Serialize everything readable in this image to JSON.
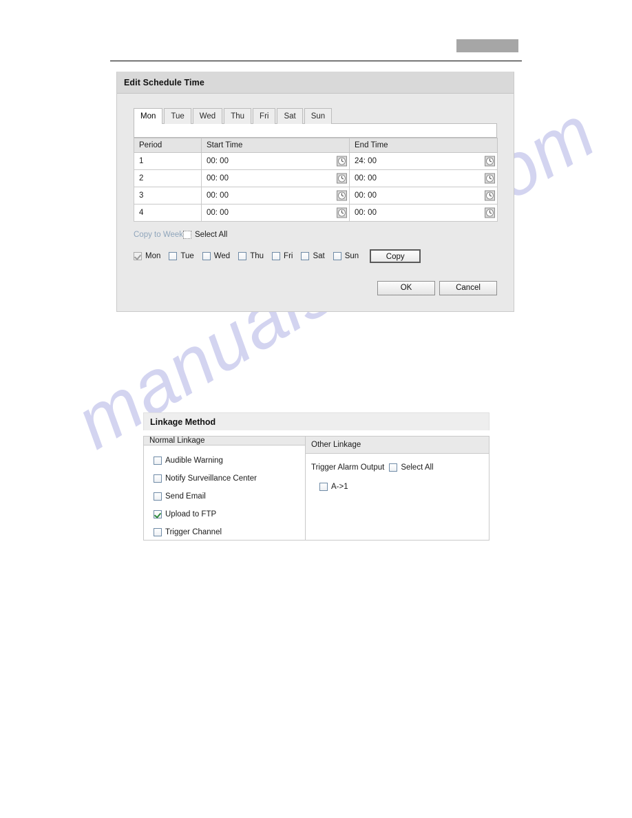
{
  "page": {
    "redaction_box_color": "#a6a6a6",
    "watermark": "manualshive.com"
  },
  "schedule_dialog": {
    "title": "Edit Schedule Time",
    "tabs": [
      {
        "label": "Mon",
        "active": true
      },
      {
        "label": "Tue",
        "active": false
      },
      {
        "label": "Wed",
        "active": false
      },
      {
        "label": "Thu",
        "active": false
      },
      {
        "label": "Fri",
        "active": false
      },
      {
        "label": "Sat",
        "active": false
      },
      {
        "label": "Sun",
        "active": false
      }
    ],
    "table": {
      "columns": [
        "Period",
        "Start Time",
        "End Time"
      ],
      "rows": [
        {
          "period": "1",
          "start": "00: 00",
          "end": "24: 00"
        },
        {
          "period": "2",
          "start": "00: 00",
          "end": "00: 00"
        },
        {
          "period": "3",
          "start": "00: 00",
          "end": "00: 00"
        },
        {
          "period": "4",
          "start": "00: 00",
          "end": "00: 00"
        }
      ],
      "picker_icon": "clock-icon"
    },
    "copy_to_week": {
      "label": "Copy to Week",
      "select_all_label": "Select All",
      "select_all_checked": false,
      "days": [
        {
          "label": "Mon",
          "checked": true,
          "disabled": true
        },
        {
          "label": "Tue",
          "checked": false,
          "disabled": false
        },
        {
          "label": "Wed",
          "checked": false,
          "disabled": false
        },
        {
          "label": "Thu",
          "checked": false,
          "disabled": false
        },
        {
          "label": "Fri",
          "checked": false,
          "disabled": false
        },
        {
          "label": "Sat",
          "checked": false,
          "disabled": false
        },
        {
          "label": "Sun",
          "checked": false,
          "disabled": false
        }
      ],
      "copy_button": "Copy"
    },
    "ok_button": "OK",
    "cancel_button": "Cancel"
  },
  "linkage_method": {
    "title": "Linkage Method",
    "normal_linkage": {
      "header": "Normal Linkage",
      "items": [
        {
          "label": "Audible Warning",
          "checked": false
        },
        {
          "label": "Notify Surveillance Center",
          "checked": false
        },
        {
          "label": "Send Email",
          "checked": false
        },
        {
          "label": "Upload to FTP",
          "checked": true
        },
        {
          "label": "Trigger Channel",
          "checked": false
        }
      ]
    },
    "other_linkage": {
      "header": "Other Linkage",
      "trigger_alarm_output_label": "Trigger Alarm Output",
      "select_all_label": "Select All",
      "select_all_checked": false,
      "outputs": [
        {
          "label": "A->1",
          "checked": false
        }
      ]
    }
  }
}
